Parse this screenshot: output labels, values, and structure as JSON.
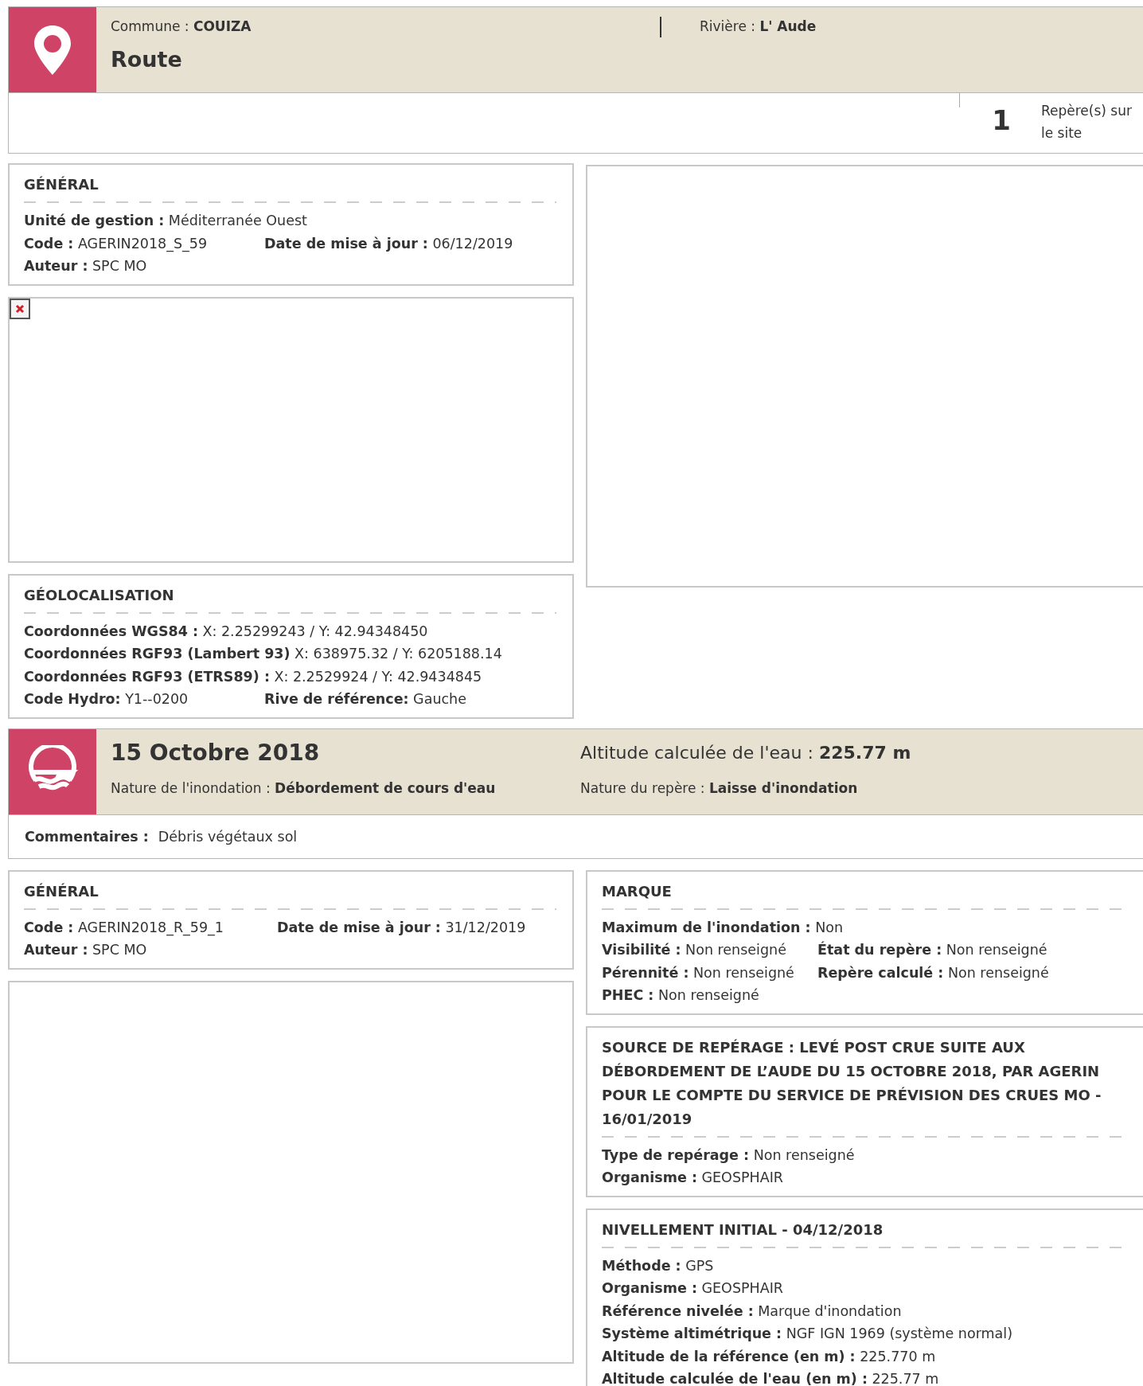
{
  "site_header": {
    "commune_label": "Commune :",
    "commune": "COUIZA",
    "title": "Route",
    "riviere_label": "Rivière :",
    "riviere": "L' Aude"
  },
  "site_marks": {
    "count": "1",
    "label": "Repère(s) sur le site"
  },
  "site_general": {
    "title": "GÉNÉRAL",
    "rows": [
      [
        {
          "label": "Unité de gestion :",
          "value": "Méditerranée Ouest"
        }
      ],
      [
        {
          "label": "Code :",
          "value": "AGERIN2018_S_59"
        },
        {
          "label": "Date de mise à jour :",
          "value": "06/12/2019"
        }
      ],
      [
        {
          "label": "Auteur :",
          "value": "SPC MO"
        }
      ]
    ]
  },
  "site_photo": {
    "broken": true
  },
  "geolocalisation": {
    "title": "GÉOLOCALISATION",
    "rows": [
      [
        {
          "label": "Coordonnées WGS84 :",
          "value": "X: 2.25299243 / Y: 42.94348450"
        }
      ],
      [
        {
          "label": "Coordonnées RGF93 (Lambert 93)",
          "value": "X: 638975.32 / Y: 6205188.14"
        }
      ],
      [
        {
          "label": "Coordonnées RGF93 (ETRS89) :",
          "value": "X: 2.2529924 / Y: 42.9434845"
        }
      ],
      [
        {
          "label": "Code Hydro:",
          "value": "Y1--0200"
        },
        {
          "label": "Rive de référence:",
          "value": "Gauche"
        }
      ]
    ]
  },
  "event_header": {
    "date": "15 Octobre 2018",
    "altitude_label": "Altitude calculée de l'eau :",
    "altitude": "225.77 m",
    "inondation_label": "Nature de l'inondation :",
    "inondation": "Débordement de cours d'eau",
    "repere_label": "Nature du repère :",
    "repere": "Laisse d'inondation"
  },
  "comments": {
    "label": "Commentaires :",
    "value": "Débris végétaux sol"
  },
  "mark_general": {
    "title": "GÉNÉRAL",
    "rows": [
      [
        {
          "label": "Code :",
          "value": "AGERIN2018_R_59_1"
        },
        {
          "label": "Date de mise à jour :",
          "value": "31/12/2019"
        }
      ],
      [
        {
          "label": "Auteur :",
          "value": "SPC MO"
        }
      ]
    ]
  },
  "marque": {
    "title": "MARQUE",
    "rows": [
      [
        {
          "label": "Maximum de l'inondation :",
          "value": "Non"
        }
      ],
      [
        {
          "label": "Visibilité :",
          "value": "Non renseigné"
        },
        {
          "label": "État du repère :",
          "value": "Non renseigné"
        }
      ],
      [
        {
          "label": "Pérennité :",
          "value": "Non renseigné"
        },
        {
          "label": "Repère calculé :",
          "value": "Non renseigné"
        }
      ],
      [
        {
          "label": "PHEC :",
          "value": "Non renseigné"
        }
      ]
    ]
  },
  "source": {
    "title": "SOURCE DE REPÉRAGE : LEVÉ POST CRUE SUITE AUX DÉBORDEMENT DE L’AUDE DU 15 OCTOBRE 2018, PAR AGERIN POUR LE COMPTE DU SERVICE DE PRÉVISION DES CRUES MO - 16/01/2019",
    "rows": [
      [
        {
          "label": "Type de repérage :",
          "value": "Non renseigné"
        }
      ],
      [
        {
          "label": "Organisme :",
          "value": "GEOSPHAIR"
        }
      ]
    ]
  },
  "nivellement": {
    "title": "NIVELLEMENT INITIAL - 04/12/2018",
    "rows": [
      [
        {
          "label": "Méthode :",
          "value": "GPS"
        }
      ],
      [
        {
          "label": "Organisme :",
          "value": "GEOSPHAIR"
        }
      ],
      [
        {
          "label": "Référence nivelée :",
          "value": "Marque d'inondation"
        }
      ],
      [
        {
          "label": "Système altimétrique :",
          "value": "NGF IGN 1969 (système normal)"
        }
      ],
      [
        {
          "label": "Altitude de la référence (en m) :",
          "value": "225.770 m"
        }
      ],
      [
        {
          "label": "Altitude calculée de l'eau (en m) :",
          "value": "225.77 m"
        }
      ]
    ]
  }
}
